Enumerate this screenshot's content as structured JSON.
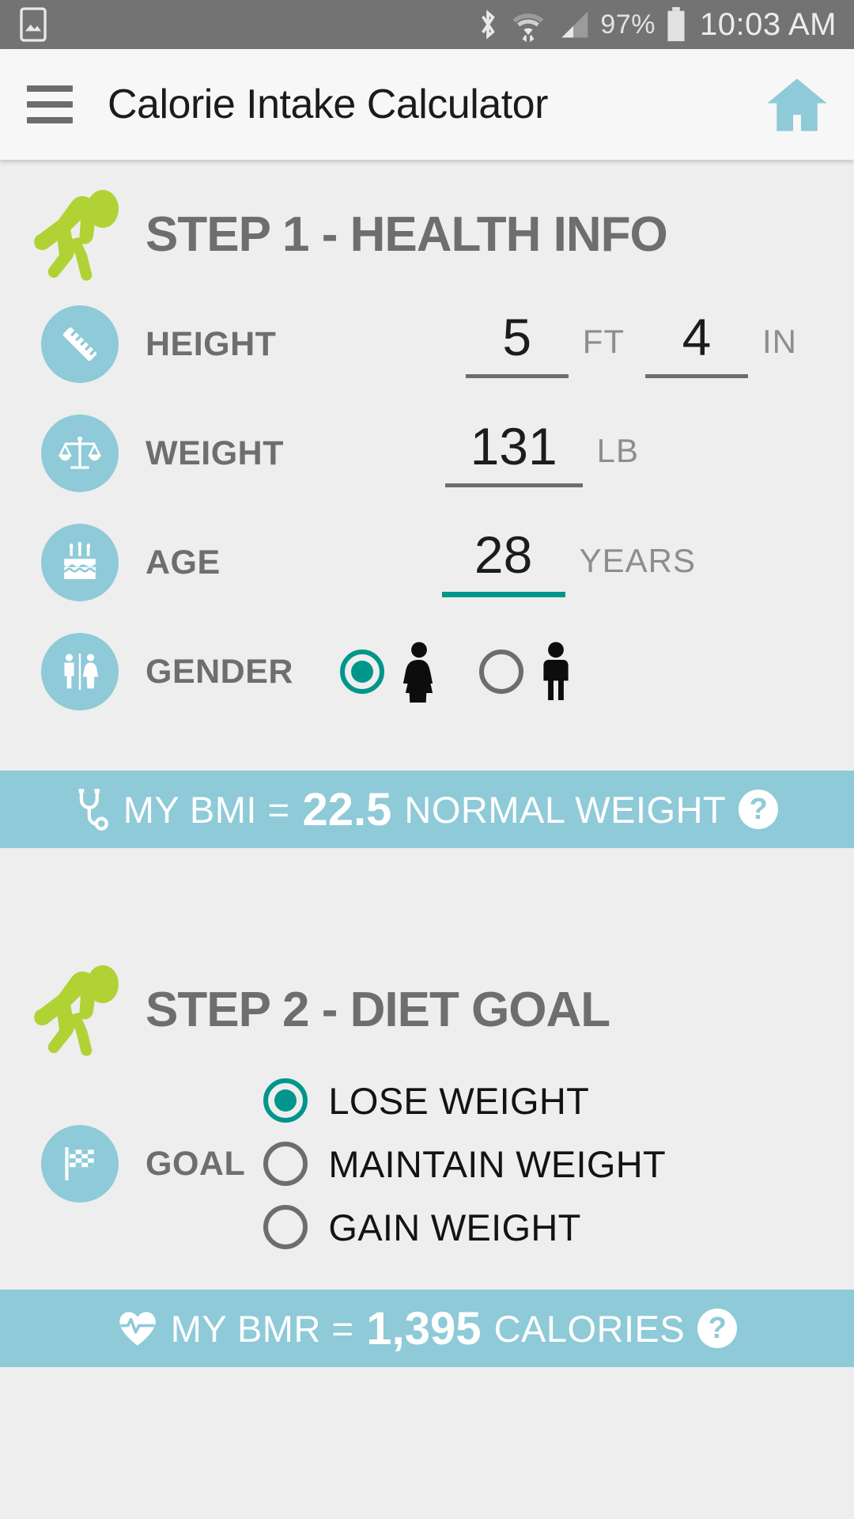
{
  "status_bar": {
    "icons": [
      "screenshot-icon",
      "bluetooth-icon",
      "wifi-icon",
      "cellular-signal-icon",
      "battery-icon"
    ],
    "battery_percent": "97%",
    "time": "10:03 AM"
  },
  "app_bar": {
    "menu_icon": "hamburger-menu-icon",
    "title": "Calorie Intake Calculator",
    "home_icon": "home-icon"
  },
  "step1": {
    "icon": "green-runner-icon",
    "title": "STEP 1 - HEALTH INFO",
    "height": {
      "icon": "ruler-icon",
      "label": "HEIGHT",
      "feet_value": "5",
      "feet_unit": "FT",
      "inches_value": "4",
      "inches_unit": "IN"
    },
    "weight": {
      "icon": "balance-scale-icon",
      "label": "WEIGHT",
      "value": "131",
      "unit": "LB"
    },
    "age": {
      "icon": "birthday-cake-icon",
      "label": "AGE",
      "value": "28",
      "unit": "YEARS",
      "focused": true
    },
    "gender": {
      "icon": "restroom-gender-icon",
      "label": "GENDER",
      "options": [
        {
          "name": "female",
          "icon": "female-figure-icon",
          "selected": true
        },
        {
          "name": "male",
          "icon": "male-figure-icon",
          "selected": false
        }
      ]
    }
  },
  "bmi_banner": {
    "icon": "stethoscope-icon",
    "prefix": "MY BMI =",
    "value": "22.5",
    "suffix": "NORMAL WEIGHT",
    "help_icon": "question-mark-icon",
    "help_label": "?"
  },
  "step2": {
    "icon": "green-runner-icon",
    "title": "STEP 2 - DIET GOAL",
    "goal": {
      "icon": "checkered-flag-icon",
      "label": "GOAL",
      "options": [
        {
          "label": "LOSE WEIGHT",
          "selected": true
        },
        {
          "label": "MAINTAIN WEIGHT",
          "selected": false
        },
        {
          "label": "GAIN WEIGHT",
          "selected": false
        }
      ]
    }
  },
  "bmr_banner": {
    "icon": "heart-pulse-icon",
    "prefix": "MY BMR =",
    "value": "1,395",
    "suffix": "CALORIES",
    "help_icon": "question-mark-icon",
    "help_label": "?"
  },
  "colors": {
    "accent_teal": "#00968b",
    "banner_blue": "#8ecad8",
    "green": "#b0d235",
    "status_bar": "#737373",
    "background": "#eeeeee"
  }
}
